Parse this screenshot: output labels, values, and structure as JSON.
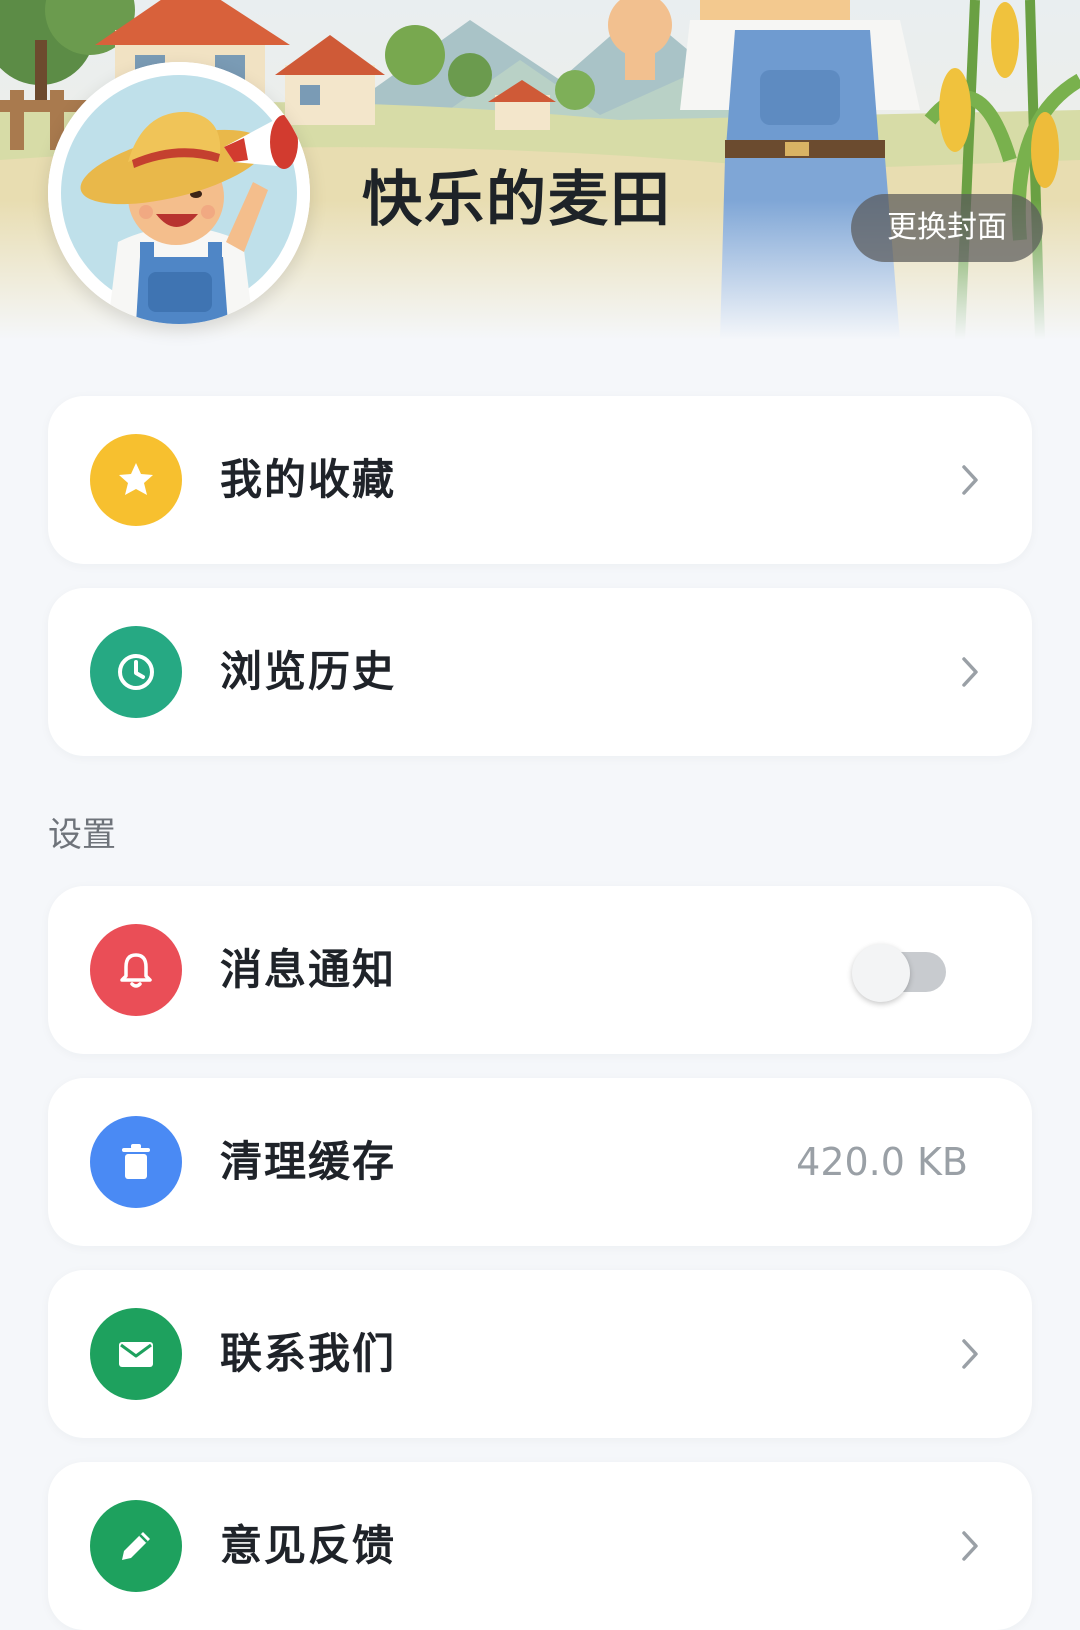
{
  "profile": {
    "username": "快乐的麦田",
    "change_cover_label": "更换封面"
  },
  "menu": {
    "favorites": {
      "label": "我的收藏",
      "icon": "star-icon",
      "color": "#f7c02f"
    },
    "history": {
      "label": "浏览历史",
      "icon": "clock-icon",
      "color": "#26a983"
    }
  },
  "settings": {
    "section_title": "设置",
    "notifications": {
      "label": "消息通知",
      "icon": "bell-icon",
      "color": "#ea4e57",
      "enabled": false
    },
    "clear_cache": {
      "label": "清理缓存",
      "icon": "trash-icon",
      "color": "#4a8af4",
      "value": "420.0 KB"
    },
    "contact": {
      "label": "联系我们",
      "icon": "mail-icon",
      "color": "#1ea15e"
    },
    "feedback": {
      "label": "意见反馈",
      "icon": "pencil-icon",
      "color": "#1ea15e"
    }
  }
}
